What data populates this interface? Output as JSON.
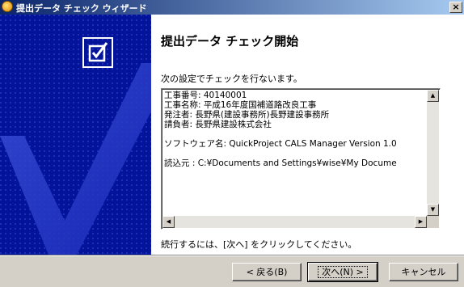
{
  "window": {
    "title": "提出データ チェック ウィザード",
    "close_glyph": "×"
  },
  "page": {
    "heading": "提出データ チェック開始",
    "intro": "次の設定でチェックを行ないます。",
    "details": [
      "工事番号: 40140001",
      "工事名称: 平成16年度国補道路改良工事",
      "発注者: 長野県(建設事務所)長野建設事務所",
      "請負者: 長野県建設株式会社",
      "",
      "ソフトウェア名: QuickProject CALS Manager Version 1.0",
      "",
      "読込元 : C:¥Documents and Settings¥wise¥My Docume"
    ],
    "continue_hint": "続行するには、[次へ] をクリックしてください。"
  },
  "buttons": {
    "back": "< 戻る(B)",
    "next": "次へ(N) >",
    "cancel": "キャンセル"
  },
  "icons": {
    "app": "wizard-app-icon",
    "check": "check-document-icon"
  },
  "colors": {
    "titlebar_start": "#0a246a",
    "titlebar_end": "#a6caf0",
    "sidebar": "#04149a",
    "dialog": "#d4d0c8"
  }
}
